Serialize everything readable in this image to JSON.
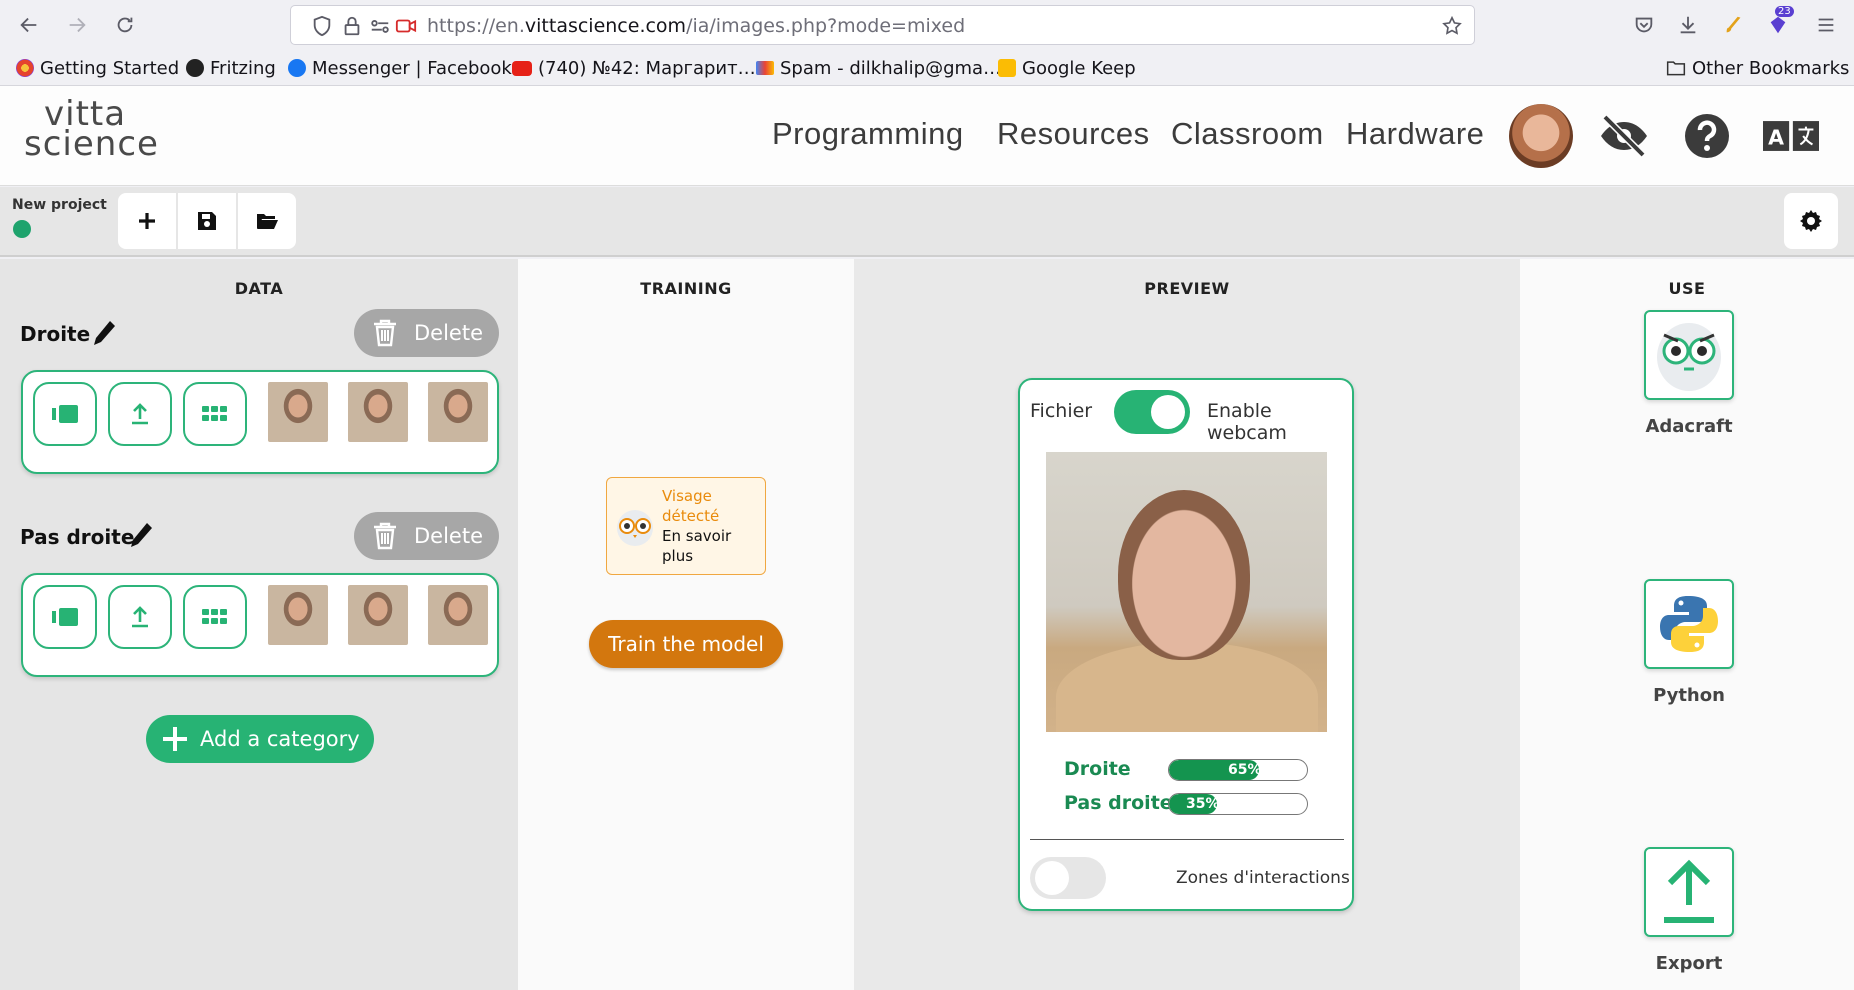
{
  "browser": {
    "url_prefix": "https://en.",
    "url_domain": "vittascience.com",
    "url_path": "/ia/images.php?mode=mixed",
    "extension_badge": "23",
    "bookmarks": [
      "Getting Started",
      "Fritzing",
      "Messenger | Facebook",
      "(740) №42: Маргарит…",
      "Spam - dilkhalip@gma…",
      "Google Keep"
    ],
    "other_bookmarks": "Other Bookmarks"
  },
  "header": {
    "logo_top": "vitta",
    "logo_bottom": "science",
    "nav": [
      "Programming",
      "Resources",
      "Classroom",
      "Hardware"
    ]
  },
  "project": {
    "name": "New project",
    "status_color": "#1ea36d"
  },
  "data_col": {
    "title": "DATA",
    "delete_label": "Delete",
    "categories": [
      {
        "name": "Droite"
      },
      {
        "name": "Pas droite"
      }
    ],
    "add_category": "Add a category"
  },
  "training": {
    "title": "TRAINING",
    "info_title": "Visage détecté",
    "info_link": "En savoir plus",
    "train_button": "Train the model"
  },
  "preview": {
    "title": "PREVIEW",
    "file_label": "Fichier",
    "webcam_label": "Enable webcam",
    "webcam_enabled": true,
    "predictions": [
      {
        "label": "Droite",
        "value": 0.65,
        "text": "65%"
      },
      {
        "label": "Pas droite",
        "value": 0.35,
        "text": "35%"
      }
    ],
    "zones_label": "Zones d'interactions",
    "zones_enabled": false
  },
  "use": {
    "title": "USE",
    "items": [
      "Adacraft",
      "Python",
      "Export"
    ]
  },
  "colors": {
    "accent_green": "#27b374",
    "train_orange": "#d3770e",
    "delete_gray": "#a7a7a7"
  }
}
